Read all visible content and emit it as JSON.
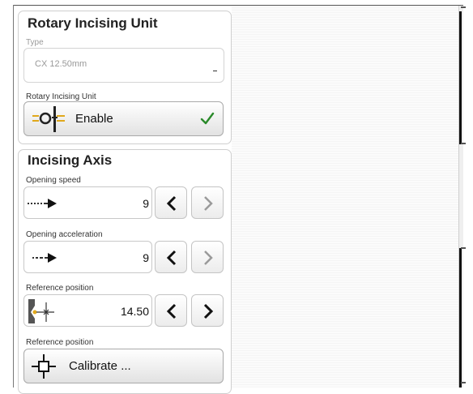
{
  "rotary_unit": {
    "title": "Rotary Incising Unit",
    "type_label": "Type",
    "type_value": "CX 12.50mm",
    "enable_label": "Rotary Incising Unit",
    "enable_button": "Enable",
    "enable_checked": true
  },
  "incising_axis": {
    "title": "Incising Axis",
    "opening_speed": {
      "label": "Opening speed",
      "value": "9"
    },
    "opening_acceleration": {
      "label": "Opening acceleration",
      "value": "9"
    },
    "reference_position": {
      "label": "Reference position",
      "value": "14.50"
    },
    "calibrate": {
      "label": "Reference position",
      "button": "Calibrate ..."
    }
  },
  "icons": {
    "incising_unit": "rotary-incising-unit-icon",
    "check": "checkmark-icon",
    "speed": "speed-arrow-icon",
    "acceleration": "acceleration-arrow-icon",
    "reference": "reference-position-icon",
    "calibrate": "calibrate-crosshair-icon",
    "prev": "chevron-left-icon",
    "next": "chevron-right-icon"
  },
  "colors": {
    "check": "#2a8a2a",
    "accent": "#e0a81c"
  }
}
